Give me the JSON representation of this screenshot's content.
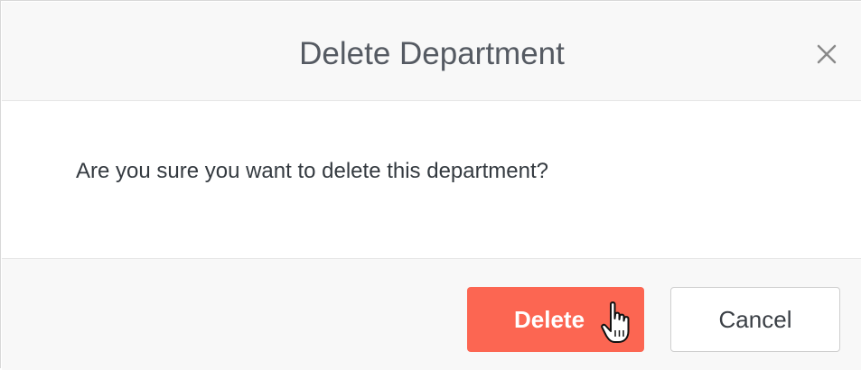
{
  "dialog": {
    "title": "Delete Department",
    "close_icon": "close-icon",
    "message": "Are you sure you want to delete this department?",
    "buttons": {
      "delete_label": "Delete",
      "cancel_label": "Cancel"
    }
  },
  "cursor": {
    "icon": "hand-pointer-icon"
  },
  "colors": {
    "delete_button_bg": "#fc6652",
    "title_text": "#555a62",
    "header_bg": "#f8f8f8"
  }
}
